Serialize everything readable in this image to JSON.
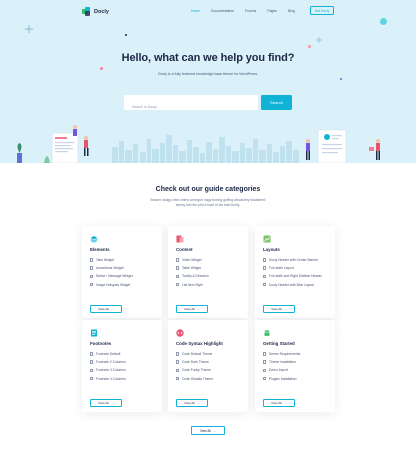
{
  "brand": {
    "name": "Docly"
  },
  "nav": {
    "links": [
      "Home",
      "Documentation",
      "Forums",
      "Pages",
      "Blog"
    ],
    "active_index": 0,
    "cta_label": "Get Docly"
  },
  "hero": {
    "title": "Hello, what can we help you find?",
    "subtitle": "Docly is a fully featured knowledge base theme for WordPress.",
    "search_placeholder": "Search in Docly...",
    "search_button": "Search"
  },
  "categories_section": {
    "title": "Check out our guide categories",
    "subtitle": "Bowler dodgy chim chims wrongun nags boxing guffing absolutely bladdered barmy lost the plot a load of old tosh brolly."
  },
  "cards": [
    {
      "title": "Elements",
      "icon": "stack-icon",
      "items": [
        "Tabs Widget",
        "Accordions Widget",
        "Notice / Message Widget",
        "Image Hotspots Widget"
      ],
      "button": "View All"
    },
    {
      "title": "Content",
      "icon": "content-icon",
      "items": [
        "Video Widget",
        "Table Widget",
        "Tooltip & Direction",
        "List Item Style"
      ],
      "button": "View All"
    },
    {
      "title": "Layouts",
      "icon": "layout-icon",
      "items": [
        "Docly Header with Center Banner",
        "Full width Layout",
        "Full width and Right Sidebar Header",
        "Docly Header with Blue Layout"
      ],
      "button": "View All"
    },
    {
      "title": "Footnotes",
      "icon": "document-icon",
      "items": [
        "Footnote Default",
        "Footnote 2 Columns",
        "Footnote 3 Columns",
        "Footnote 4 Columns"
      ],
      "button": "View All"
    },
    {
      "title": "Code Syntax Highlight",
      "icon": "code-icon",
      "items": [
        "Code Default Theme",
        "Code Dark Theme",
        "Code Funky Theme",
        "Code Okaidia Theme"
      ],
      "button": "View All"
    },
    {
      "title": "Getting Started",
      "icon": "android-icon",
      "items": [
        "Server Requirements",
        "Theme Installation",
        "Demo Import",
        "Plugins Installation"
      ],
      "button": "View All"
    }
  ],
  "footer_button": "View All",
  "colors": {
    "accent": "#10b3d6",
    "hero_bg": "#dbf1f9",
    "heading": "#1d2746"
  }
}
